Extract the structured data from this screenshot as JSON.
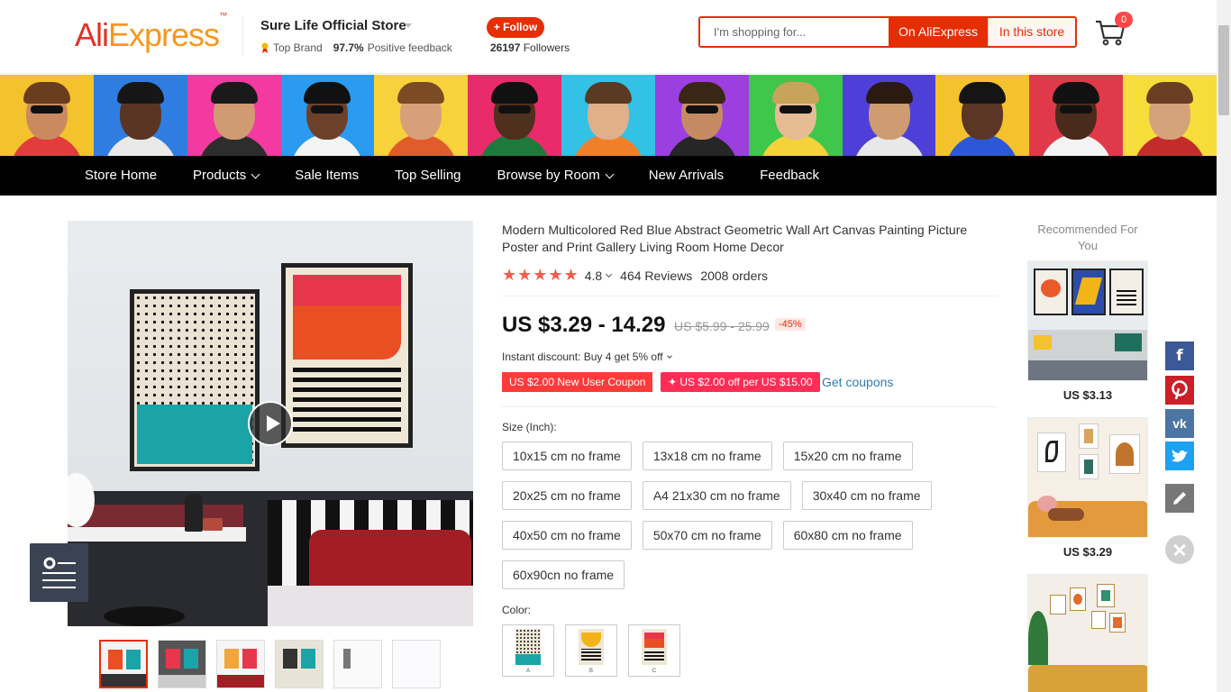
{
  "header": {
    "logo": {
      "ali": "Ali",
      "express": "Express",
      "tm": "™"
    },
    "store_name": "Sure Life Official Store",
    "top_brand": "Top Brand",
    "positive_pct": "97.7%",
    "positive_label": "Positive feedback",
    "follow_label": "+ Follow",
    "followers_count": "26197",
    "followers_label": "Followers",
    "search_placeholder": "I'm shopping for...",
    "btn_on_aliexpress": "On AliExpress",
    "btn_in_store": "In this store",
    "cart_count": "0"
  },
  "nav": {
    "items": [
      {
        "label": "Store Home",
        "dropdown": false
      },
      {
        "label": "Products",
        "dropdown": true
      },
      {
        "label": "Sale Items",
        "dropdown": false
      },
      {
        "label": "Top Selling",
        "dropdown": false
      },
      {
        "label": "Browse by Room",
        "dropdown": true
      },
      {
        "label": "New Arrivals",
        "dropdown": false
      },
      {
        "label": "Feedback",
        "dropdown": false
      }
    ]
  },
  "product": {
    "title": "Modern Multicolored Red Blue Abstract Geometric Wall Art Canvas Painting Picture Poster and Print Gallery Living Room Home Decor",
    "stars": "★★★★★",
    "rating": "4.8",
    "reviews": "464 Reviews",
    "orders": "2008 orders",
    "price": "US $3.29 - 14.29",
    "old_price": "US $5.99 - 25.99",
    "discount": "-45%",
    "instant_discount": "Instant discount: Buy 4 get 5% off",
    "coupon_new_user": "US $2.00 New User Coupon",
    "coupon_off": "✦ US $2.00 off per US $15.00",
    "get_coupons": "Get coupons",
    "size_label": "Size (Inch):",
    "sizes": [
      "10x15 cm no frame",
      "13x18 cm no frame",
      "15x20 cm no frame",
      "20x25 cm no frame",
      "A4 21x30 cm no frame",
      "30x40 cm no frame",
      "40x50 cm no frame",
      "50x70 cm no frame",
      "60x80 cm no frame",
      "60x90cn no frame"
    ],
    "color_label": "Color:",
    "colors": [
      "A",
      "B",
      "C"
    ]
  },
  "recommended": {
    "title": "Recommended For You",
    "items": [
      {
        "price": "US $3.13"
      },
      {
        "price": "US $3.29"
      },
      {
        "price": ""
      }
    ]
  },
  "colors": {
    "accent": "#e62e04",
    "nav_bg": "#000000",
    "facebook": "#3b5998",
    "pinterest": "#cb2027",
    "vk": "#4c75a3",
    "twitter": "#1da1f2",
    "edit": "#777777"
  },
  "icons": {
    "cart": "cart-icon",
    "play": "play-icon",
    "settings": "settings-list-icon",
    "social": [
      "facebook-icon",
      "pinterest-icon",
      "vk-icon",
      "twitter-icon",
      "edit-icon",
      "close-icon"
    ]
  }
}
